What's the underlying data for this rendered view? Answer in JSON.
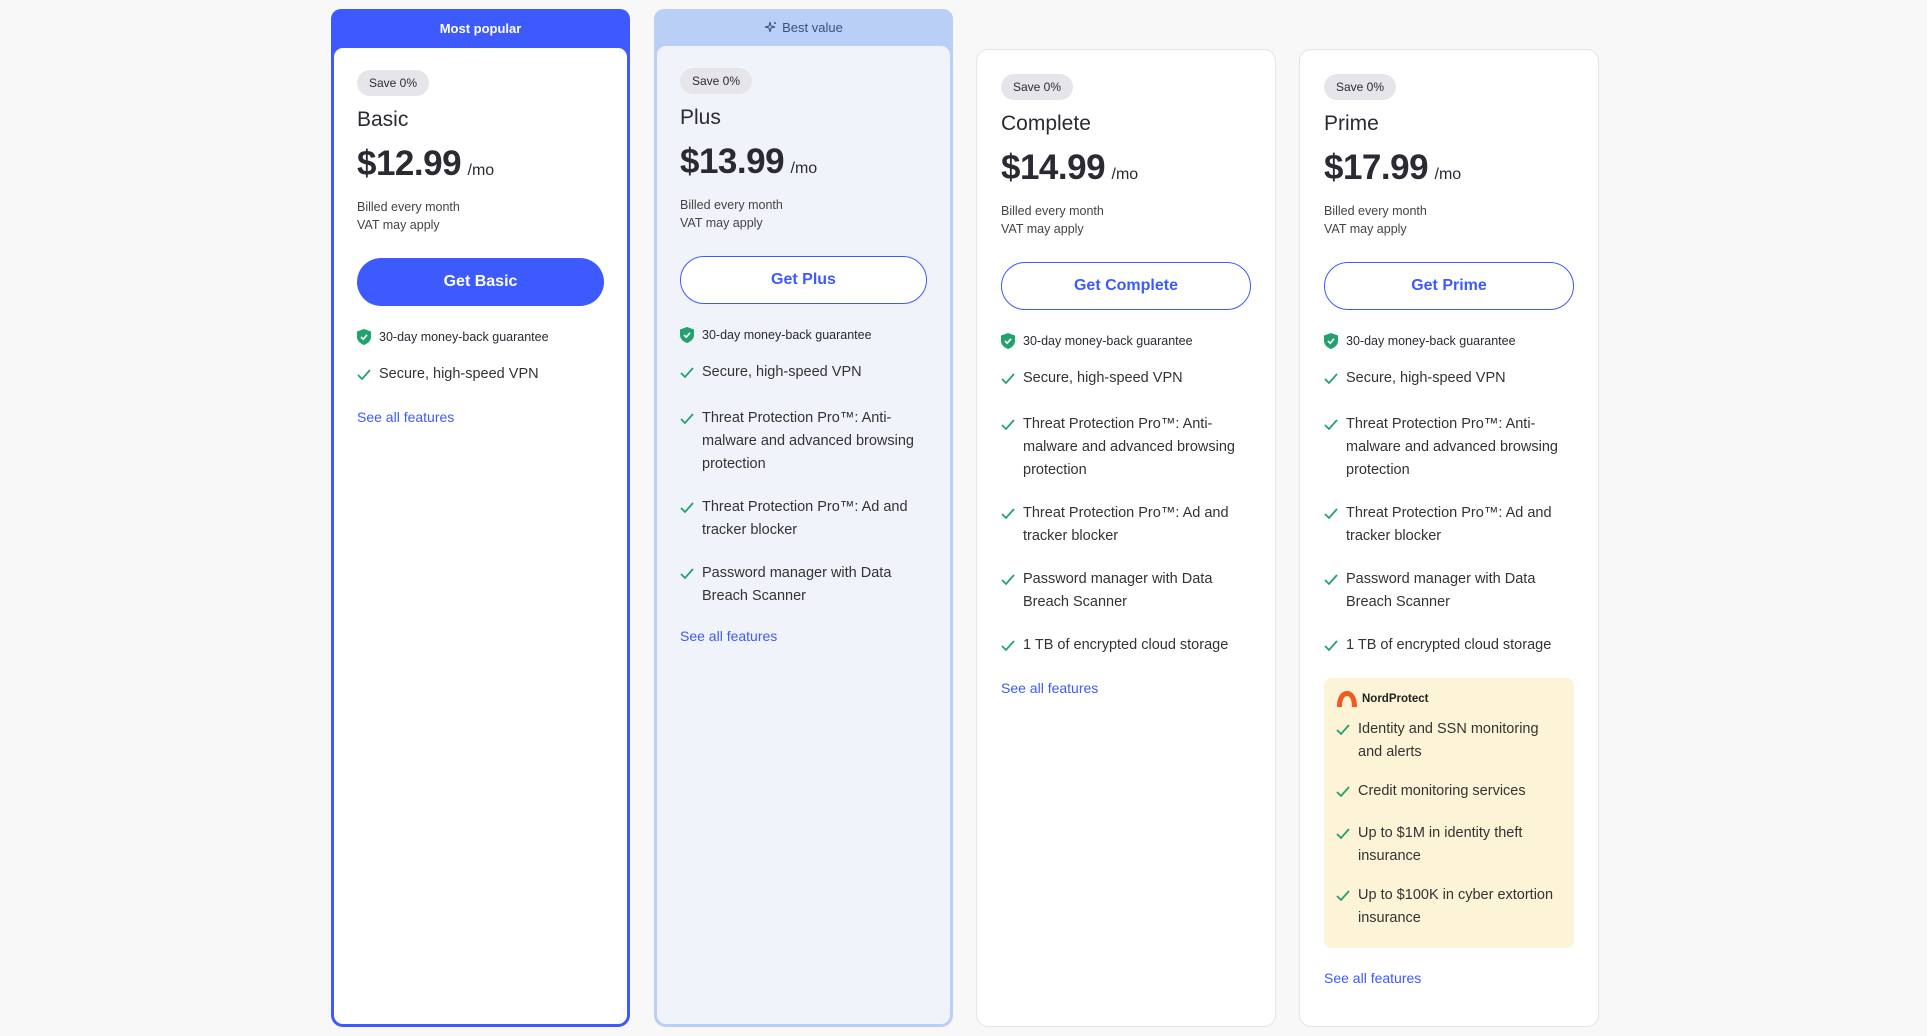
{
  "plans": [
    {
      "ribbon": "Most popular",
      "save": "Save 0%",
      "name": "Basic",
      "price": "$12.99",
      "per": "/mo",
      "billed": "Billed every month",
      "vat": "VAT may apply",
      "cta": "Get Basic",
      "guarantee": "30-day money-back guarantee",
      "features": [
        "Secure, high-speed VPN"
      ],
      "see_all": "See all features"
    },
    {
      "ribbon": "Best value",
      "save": "Save 0%",
      "name": "Plus",
      "price": "$13.99",
      "per": "/mo",
      "billed": "Billed every month",
      "vat": "VAT may apply",
      "cta": "Get Plus",
      "guarantee": "30-day money-back guarantee",
      "features": [
        "Secure, high-speed VPN",
        "Threat Protection Pro™: Anti-malware and advanced browsing protection",
        "Threat Protection Pro™: Ad and tracker blocker",
        "Password manager with Data Breach Scanner"
      ],
      "see_all": "See all features"
    },
    {
      "save": "Save 0%",
      "name": "Complete",
      "price": "$14.99",
      "per": "/mo",
      "billed": "Billed every month",
      "vat": "VAT may apply",
      "cta": "Get Complete",
      "guarantee": "30-day money-back guarantee",
      "features": [
        "Secure, high-speed VPN",
        "Threat Protection Pro™: Anti-malware and advanced browsing protection",
        "Threat Protection Pro™: Ad and tracker blocker",
        "Password manager with Data Breach Scanner",
        "1 TB of encrypted cloud storage"
      ],
      "see_all": "See all features"
    },
    {
      "save": "Save 0%",
      "name": "Prime",
      "price": "$17.99",
      "per": "/mo",
      "billed": "Billed every month",
      "vat": "VAT may apply",
      "cta": "Get Prime",
      "guarantee": "30-day money-back guarantee",
      "features": [
        "Secure, high-speed VPN",
        "Threat Protection Pro™: Anti-malware and advanced browsing protection",
        "Threat Protection Pro™: Ad and tracker blocker",
        "Password manager with Data Breach Scanner",
        "1 TB of encrypted cloud storage"
      ],
      "nordprotect": {
        "logo": "NordProtect",
        "features": [
          "Identity and SSN monitoring and alerts",
          "Credit monitoring services",
          "Up to $1M in identity theft insurance",
          "Up to $100K in cyber extortion insurance"
        ]
      },
      "see_all": "See all features"
    }
  ],
  "colors": {
    "accent": "#3d5afe",
    "best_value_ribbon": "#b9cff5",
    "check": "#23a26d",
    "nordprotect_bg": "#fdf3d6",
    "nordprotect_logo": "#f05a1e"
  },
  "icons": {
    "guarantee": "shield-check-icon",
    "feature": "checkmark-icon",
    "best_value": "sparkle-icon",
    "nordprotect": "nordprotect-logo-icon"
  }
}
